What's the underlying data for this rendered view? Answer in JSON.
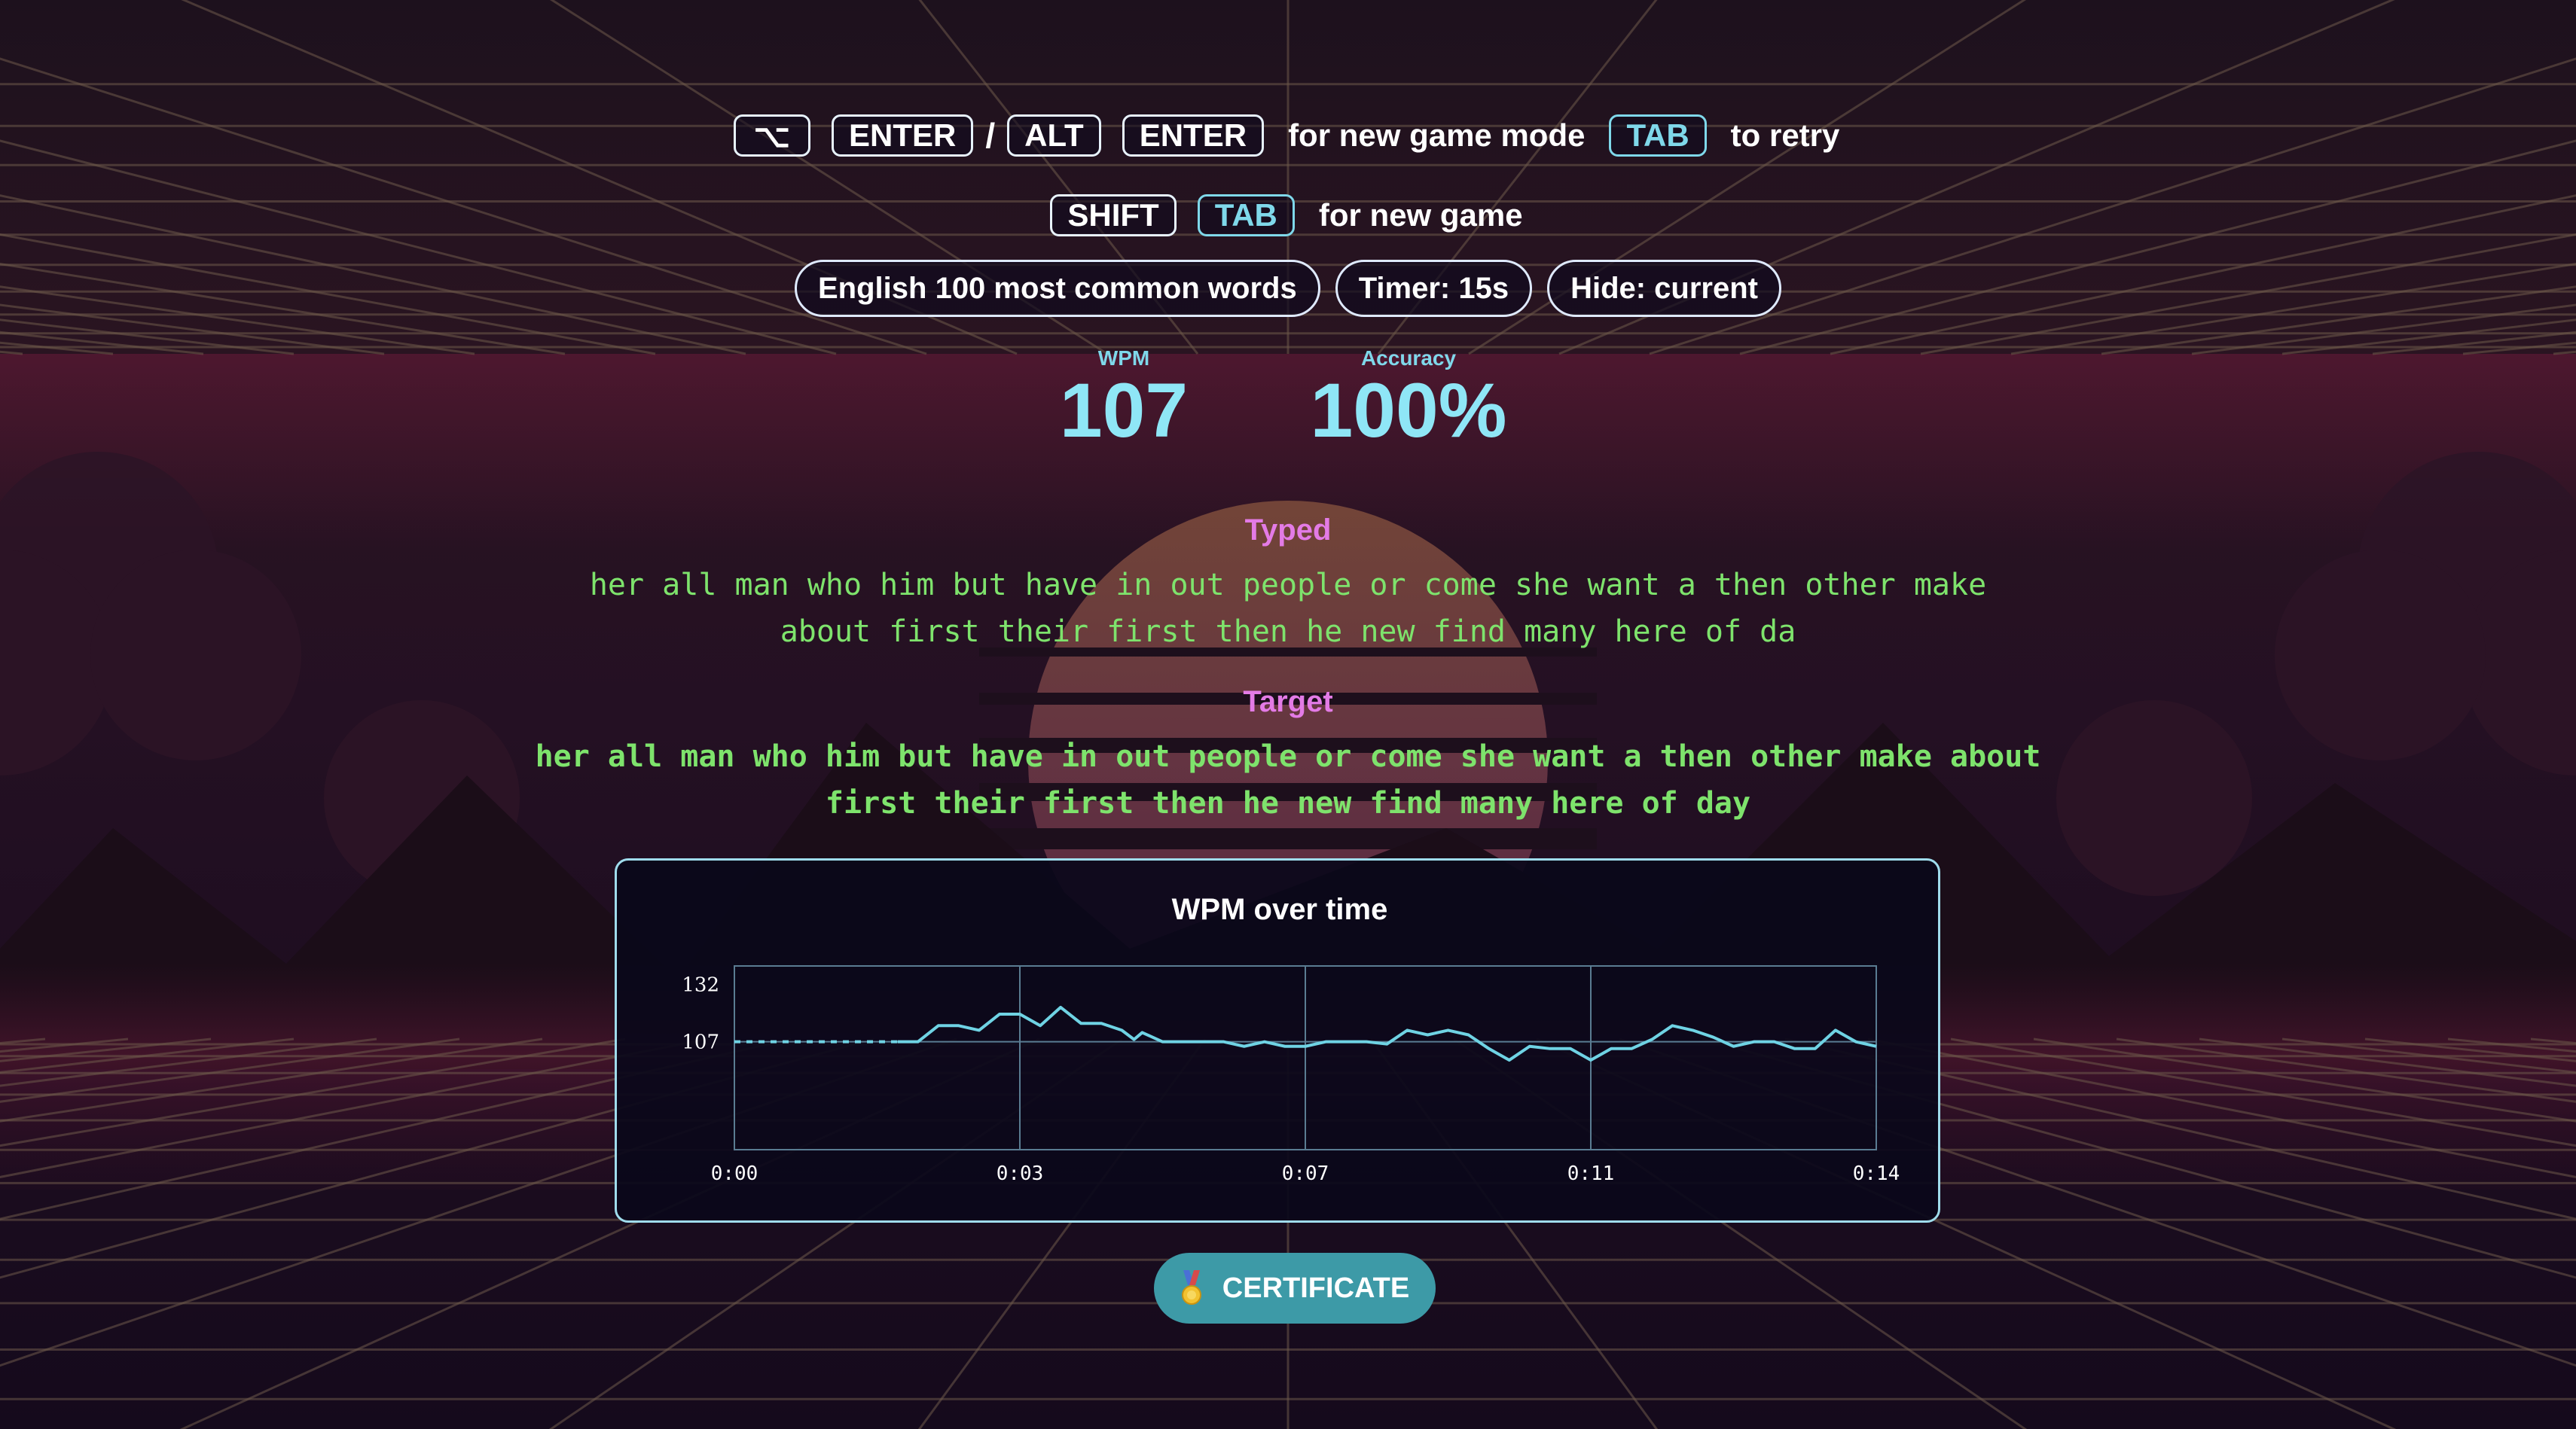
{
  "shortcuts": {
    "row1": {
      "option_key": "⌥",
      "enter_key_1": "ENTER",
      "slash": "/",
      "alt_key": "ALT",
      "enter_key_2": "ENTER",
      "new_mode_hint": "for new game mode",
      "tab_key": "TAB",
      "retry_hint": "to retry"
    },
    "row2": {
      "shift_key": "SHIFT",
      "tab_key": "TAB",
      "new_game_hint": "for new game"
    }
  },
  "settings": {
    "language": "English 100 most common words",
    "timer": "Timer: 15s",
    "hide": "Hide: current"
  },
  "stats": {
    "wpm_label": "WPM",
    "wpm_value": "107",
    "accuracy_label": "Accuracy",
    "accuracy_value": "100%"
  },
  "typed": {
    "title": "Typed",
    "line1": "her all man who him but have in out people or come she want a then other make",
    "line2": "about first their first then he new find many here of da"
  },
  "target": {
    "title": "Target",
    "line1": "her all man who him but have in out people or come she want a then other make about",
    "line2": "first their first then he new find many here of day"
  },
  "chart_data": {
    "type": "line",
    "title": "WPM over time",
    "xlabel": "",
    "ylabel": "",
    "x_tick_labels": [
      "0:00",
      "0:03",
      "0:07",
      "0:11",
      "0:14"
    ],
    "y_tick_labels": [
      "132",
      "107"
    ],
    "x_range_seconds": [
      0,
      14
    ],
    "reference_line": 107,
    "grid": true,
    "colors": {
      "line": "#6fd3e4",
      "grid": "#5a7c92",
      "text": "#ffffff"
    },
    "series": [
      {
        "style": "dashed",
        "x": [
          0,
          2.0
        ],
        "values": [
          107,
          107
        ]
      },
      {
        "style": "solid",
        "x": [
          2.0,
          2.25,
          2.5,
          2.75,
          3.0,
          3.25,
          3.5,
          3.75,
          4.0,
          4.25,
          4.5,
          4.75,
          4.9,
          5.0,
          5.25,
          5.5,
          5.75,
          6.0,
          6.25,
          6.5,
          6.75,
          7.0,
          7.25,
          7.5,
          7.75,
          8.0,
          8.25,
          8.5,
          8.75,
          9.0,
          9.25,
          9.5,
          9.75,
          10.0,
          10.25,
          10.5,
          10.75,
          11.0,
          11.25,
          11.5,
          11.75,
          12.0,
          12.25,
          12.5,
          12.75,
          13.0,
          13.25,
          13.5,
          13.75,
          14.0
        ],
        "values": [
          107,
          107,
          114,
          114,
          112,
          119,
          119,
          114,
          122,
          115,
          115,
          112,
          108,
          111,
          107,
          107,
          107,
          107,
          105,
          107,
          105,
          105,
          107,
          107,
          107,
          106,
          112,
          110,
          112,
          110,
          104,
          99,
          105,
          104,
          104,
          99,
          104,
          104,
          108,
          114,
          112,
          109,
          105,
          107,
          107,
          104,
          104,
          112,
          107,
          105
        ]
      }
    ]
  },
  "certificate": {
    "label": "CERTIFICATE",
    "icon": "medal-icon"
  }
}
